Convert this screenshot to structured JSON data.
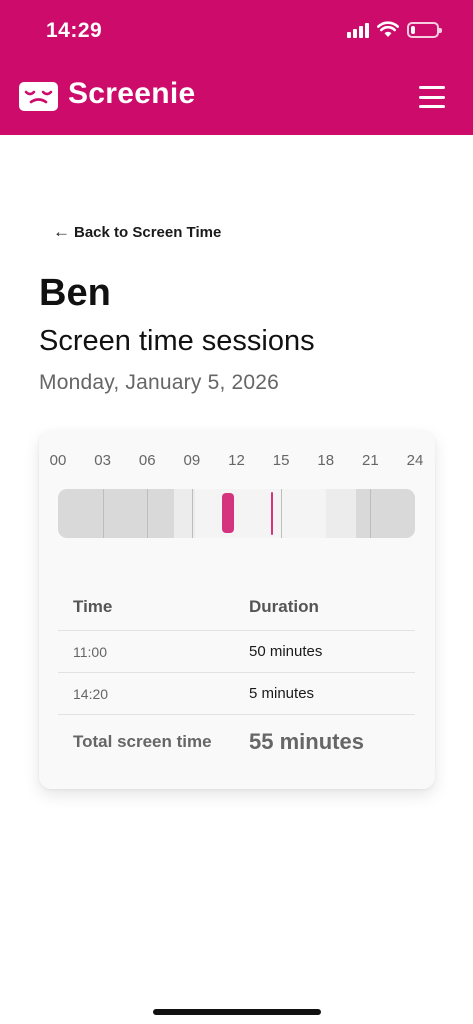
{
  "colors": {
    "brand": "#cc0b6b",
    "accent": "#d6337f",
    "timeline_dark": "#d9d9d9",
    "timeline_light": "#ececec",
    "timeline_lightest": "#f4f4f4"
  },
  "status_bar": {
    "time": "14:29",
    "icons": [
      "signal-icon",
      "wifi-icon",
      "battery-icon"
    ],
    "battery_level": 0.18
  },
  "app_bar": {
    "brand_name": "Screenie",
    "logo_icon": "sleepy-face-logo",
    "menu_icon": "hamburger-menu-icon"
  },
  "nav": {
    "back_arrow": "←",
    "back_label": "Back to Screen Time"
  },
  "profile": {
    "name": "Ben"
  },
  "page": {
    "title": "Screen time sessions",
    "date": "Monday, January 5, 2026"
  },
  "timeline": {
    "hour_labels": [
      "00",
      "03",
      "06",
      "09",
      "12",
      "15",
      "18",
      "21",
      "24"
    ],
    "range_hours": [
      0,
      24
    ],
    "shading": [
      {
        "from": 0,
        "to": 7.8,
        "shade": "dark"
      },
      {
        "from": 7.8,
        "to": 9.2,
        "shade": "light"
      },
      {
        "from": 9.2,
        "to": 18,
        "shade": "lightest"
      },
      {
        "from": 18,
        "to": 20,
        "shade": "light"
      },
      {
        "from": 20,
        "to": 24,
        "shade": "dark"
      }
    ],
    "ticks": [
      3,
      6,
      9,
      15,
      21
    ],
    "sessions": [
      {
        "start": 11.0,
        "minutes": 50
      },
      {
        "start": 14.333,
        "minutes": 5
      }
    ]
  },
  "table": {
    "headers": {
      "time": "Time",
      "duration": "Duration"
    },
    "rows": [
      {
        "time": "11:00",
        "duration": "50 minutes"
      },
      {
        "time": "14:20",
        "duration": "5 minutes"
      }
    ],
    "total": {
      "label": "Total screen time",
      "value": "55 minutes"
    }
  }
}
